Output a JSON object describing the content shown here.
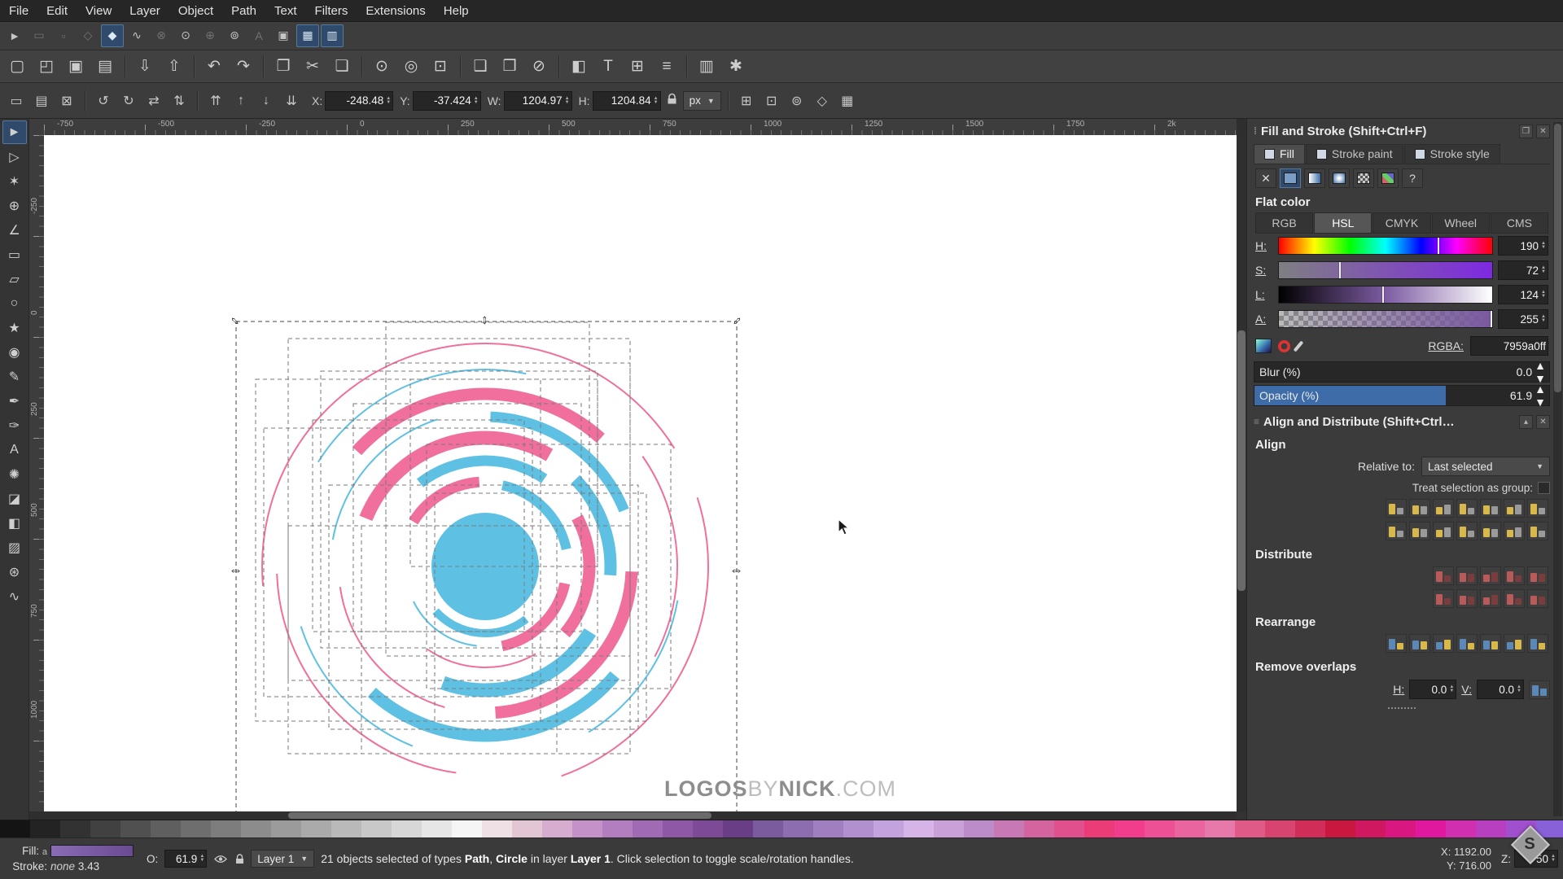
{
  "menu": {
    "items": [
      "File",
      "Edit",
      "View",
      "Layer",
      "Object",
      "Path",
      "Text",
      "Filters",
      "Extensions",
      "Help"
    ]
  },
  "snapbar": {
    "items": [
      {
        "name": "snap-toggle-icon",
        "glyph": "►"
      },
      {
        "name": "snap-bbox-icon",
        "glyph": "▭",
        "dis": true
      },
      {
        "name": "snap-bbox-edge-icon",
        "glyph": "▫",
        "dis": true
      },
      {
        "name": "snap-bbox-corner-icon",
        "glyph": "◇",
        "dis": true
      },
      {
        "name": "snap-node-icon",
        "glyph": "◆",
        "active": true
      },
      {
        "name": "snap-path-icon",
        "glyph": "∿"
      },
      {
        "name": "snap-path-intersection-icon",
        "glyph": "⊗",
        "dis": true
      },
      {
        "name": "snap-cusp-node-icon",
        "glyph": "⊙"
      },
      {
        "name": "snap-midpoint-icon",
        "glyph": "⊕",
        "dis": true
      },
      {
        "name": "snap-center-icon",
        "glyph": "⊚"
      },
      {
        "name": "snap-text-baseline-icon",
        "glyph": "A",
        "dis": true
      },
      {
        "name": "snap-page-border-icon",
        "glyph": "▣"
      },
      {
        "name": "snap-grid-icon",
        "glyph": "▦",
        "active": true
      },
      {
        "name": "snap-guide-icon",
        "glyph": "▥",
        "active": true
      }
    ]
  },
  "commands": {
    "items": [
      {
        "name": "new-document-button",
        "glyph": "▢"
      },
      {
        "name": "open-button",
        "glyph": "◰"
      },
      {
        "name": "save-button",
        "glyph": "▣"
      },
      {
        "name": "print-button",
        "glyph": "▤"
      },
      {
        "sep": true
      },
      {
        "name": "import-button",
        "glyph": "⇩"
      },
      {
        "name": "export-button",
        "glyph": "⇧"
      },
      {
        "sep": true
      },
      {
        "name": "undo-button",
        "glyph": "↶"
      },
      {
        "name": "redo-button",
        "glyph": "↷"
      },
      {
        "sep": true
      },
      {
        "name": "copy-button",
        "glyph": "❐"
      },
      {
        "name": "cut-button",
        "glyph": "✂"
      },
      {
        "name": "paste-button",
        "glyph": "❏"
      },
      {
        "sep": true
      },
      {
        "name": "zoom-selection-button",
        "glyph": "⊙"
      },
      {
        "name": "zoom-drawing-button",
        "glyph": "◎"
      },
      {
        "name": "zoom-page-button",
        "glyph": "⊡"
      },
      {
        "sep": true
      },
      {
        "name": "duplicate-button",
        "glyph": "❑"
      },
      {
        "name": "clone-button",
        "glyph": "❒"
      },
      {
        "name": "unlink-clone-button",
        "glyph": "⊘"
      },
      {
        "sep": true
      },
      {
        "name": "fill-stroke-dialog-button",
        "glyph": "◧"
      },
      {
        "name": "text-dialog-button",
        "glyph": "T"
      },
      {
        "name": "xml-editor-button",
        "glyph": "⊞"
      },
      {
        "name": "align-dialog-button",
        "glyph": "≡"
      },
      {
        "sep": true
      },
      {
        "name": "document-properties-button",
        "glyph": "▥"
      },
      {
        "name": "preferences-button",
        "glyph": "✱"
      }
    ]
  },
  "tool_options": {
    "left_icons": [
      {
        "name": "select-all-button",
        "glyph": "▭"
      },
      {
        "name": "select-all-layers-button",
        "glyph": "▤"
      },
      {
        "name": "deselect-button",
        "glyph": "⊠"
      },
      {
        "sep": true
      },
      {
        "name": "rotate-ccw-button",
        "glyph": "↺"
      },
      {
        "name": "rotate-cw-button",
        "glyph": "↻"
      },
      {
        "name": "flip-horizontal-button",
        "glyph": "⇄"
      },
      {
        "name": "flip-vertical-button",
        "glyph": "⇅"
      },
      {
        "sep": true
      },
      {
        "name": "raise-to-top-button",
        "glyph": "⇈"
      },
      {
        "name": "raise-button",
        "glyph": "↑"
      },
      {
        "name": "lower-button",
        "glyph": "↓"
      },
      {
        "name": "lower-to-bottom-button",
        "glyph": "⇊"
      }
    ],
    "fields": [
      {
        "name": "x-field",
        "label": "X:",
        "value": "-248.48"
      },
      {
        "name": "y-field",
        "label": "Y:",
        "value": "-37.424"
      },
      {
        "name": "w-field",
        "label": "W:",
        "value": "1204.97"
      },
      {
        "name": "h-field",
        "label": "H:",
        "value": "1204.84"
      }
    ],
    "unit": "px",
    "right_icons": [
      {
        "name": "affect-move-toggle",
        "glyph": "⊞"
      },
      {
        "name": "affect-scale-toggle",
        "glyph": "⊡"
      },
      {
        "name": "affect-rotate-toggle",
        "glyph": "⊚"
      },
      {
        "name": "affect-corners-toggle",
        "glyph": "◇"
      },
      {
        "name": "bbox-mode-toggle",
        "glyph": "▦"
      }
    ]
  },
  "toolbox": {
    "tools": [
      {
        "name": "selector-tool",
        "glyph": "►",
        "active": true
      },
      {
        "name": "node-tool",
        "glyph": "▷"
      },
      {
        "name": "tweak-tool",
        "glyph": "✶"
      },
      {
        "name": "zoom-tool",
        "glyph": "⊕"
      },
      {
        "name": "measure-tool",
        "glyph": "∠"
      },
      {
        "name": "rectangle-tool",
        "glyph": "▭"
      },
      {
        "name": "box3d-tool",
        "glyph": "▱"
      },
      {
        "name": "ellipse-tool",
        "glyph": "○"
      },
      {
        "name": "star-tool",
        "glyph": "★"
      },
      {
        "name": "spiral-tool",
        "glyph": "◉"
      },
      {
        "name": "pencil-tool",
        "glyph": "✎"
      },
      {
        "name": "bezier-tool",
        "glyph": "✒"
      },
      {
        "name": "calligraphy-tool",
        "glyph": "✑"
      },
      {
        "name": "text-tool",
        "glyph": "A"
      },
      {
        "name": "spray-tool",
        "glyph": "✺"
      },
      {
        "name": "eraser-tool",
        "glyph": "◪"
      },
      {
        "name": "paint-bucket-tool",
        "glyph": "◧"
      },
      {
        "name": "gradient-tool",
        "glyph": "▨"
      },
      {
        "name": "dropper-tool",
        "glyph": "⊛"
      },
      {
        "name": "connector-tool",
        "glyph": "∿"
      }
    ]
  },
  "rulers": {
    "h_labels": [
      "-750",
      "-500",
      "-250",
      "0",
      "250",
      "500",
      "750",
      "1000",
      "1250",
      "1500",
      "1750",
      "2k"
    ],
    "v_labels": [
      "-250",
      "0",
      "250",
      "500",
      "750",
      "1000"
    ]
  },
  "fill_stroke": {
    "title": "Fill and Stroke (Shift+Ctrl+F)",
    "tabs": [
      {
        "label": "Fill",
        "active": true
      },
      {
        "label": "Stroke paint"
      },
      {
        "label": "Stroke style"
      }
    ],
    "paint_buttons": [
      {
        "name": "paint-none-button",
        "glyph": "✕"
      },
      {
        "name": "paint-flat-button",
        "kind": "flat",
        "active": true
      },
      {
        "name": "paint-linear-gradient-button",
        "kind": "linear"
      },
      {
        "name": "paint-radial-gradient-button",
        "kind": "radial"
      },
      {
        "name": "paint-pattern-button",
        "kind": "pattern"
      },
      {
        "name": "paint-swatch-button",
        "kind": "swatch"
      },
      {
        "name": "paint-unknown-button",
        "glyph": "?"
      }
    ],
    "flat_color_label": "Flat color",
    "color_tabs": [
      {
        "label": "RGB"
      },
      {
        "label": "HSL",
        "active": true
      },
      {
        "label": "CMYK"
      },
      {
        "label": "Wheel"
      },
      {
        "label": "CMS"
      }
    ],
    "sliders": [
      {
        "name": "hue-slider",
        "label": "H:",
        "value": "190",
        "pos": 74.5,
        "grad": "h"
      },
      {
        "name": "saturation-slider",
        "label": "S:",
        "value": "72",
        "pos": 28.2,
        "grad": "s"
      },
      {
        "name": "lightness-slider",
        "label": "L:",
        "value": "124",
        "pos": 48.6,
        "grad": "l"
      },
      {
        "name": "alpha-slider",
        "label": "A:",
        "value": "255",
        "pos": 99.2,
        "grad": "a"
      }
    ],
    "rgba_label": "RGBA:",
    "rgba_value": "7959a0ff",
    "blur_label": "Blur (%)",
    "blur_value": "0.0",
    "blur_fill": 0,
    "opacity_label": "Opacity (%)",
    "opacity_value": "61.9",
    "opacity_fill": 65
  },
  "align": {
    "title": "Align and Distribute (Shift+Ctrl…",
    "align_header": "Align",
    "relative_label": "Relative to:",
    "relative_value": "Last selected",
    "treat_label": "Treat selection as group:",
    "row1": [
      "align-right-to-left-anchor",
      "align-left-edges",
      "center-on-vertical-axis",
      "align-right-edges",
      "align-left-to-right-anchor",
      "align-text-left",
      "align-baseline-h"
    ],
    "row2": [
      "align-bottom-to-top-anchor",
      "align-top-edges",
      "center-on-horizontal-axis",
      "align-bottom-edges",
      "align-top-to-bottom-anchor",
      "align-text-top",
      "align-baseline-v"
    ],
    "distribute_header": "Distribute",
    "dist1": [
      "distribute-left-edges",
      "distribute-centers-horizontally",
      "distribute-right-edges",
      "distribute-horizontal-gaps",
      "distribute-text-h"
    ],
    "dist2": [
      "distribute-top-edges",
      "distribute-centers-vertically",
      "distribute-bottom-edges",
      "distribute-vertical-gaps",
      "distribute-text-v"
    ],
    "rearrange_header": "Rearrange",
    "rearrange": [
      "arrange-connector-network",
      "exchange-in-selection-order",
      "exchange-in-stacking-order",
      "exchange-clockwise",
      "randomize-centers",
      "unclump",
      "remove-overlaps-icon"
    ],
    "remove_header": "Remove overlaps",
    "h_label": "H:",
    "h_value": "0.0",
    "v_label": "V:",
    "v_value": "0.0"
  },
  "statusbar": {
    "fill_label": "Fill:",
    "fill_flag": "a",
    "stroke_label": "Stroke:",
    "stroke_value": "none",
    "stroke_width": "3.43",
    "opacity_label": "O:",
    "opacity_value": "61.9",
    "layer_name": "Layer 1",
    "message": {
      "s1": "21 objects selected of types ",
      "b1": "Path",
      "s2": ", ",
      "b2": "Circle",
      "s3": " in layer ",
      "b3": "Layer 1",
      "s4": ". Click selection to toggle scale/rotation handles."
    },
    "x_label": "X:",
    "x_value": "1192.00",
    "y_label": "Y:",
    "y_value": "716.00",
    "z_label": "Z:",
    "z_value": "50"
  },
  "canvas": {
    "watermark": {
      "p1": "LOGOS",
      "p2": "BY",
      "p3": "NICK",
      "p4": ".COM"
    }
  },
  "palette": {
    "colors": [
      "#141414",
      "#232323",
      "#323232",
      "#414141",
      "#505050",
      "#5f5f5f",
      "#6e6e6e",
      "#7d7d7d",
      "#8c8c8c",
      "#9b9b9b",
      "#aaaaaa",
      "#b9b9b9",
      "#c8c8c8",
      "#d7d7d7",
      "#e6e6e6",
      "#f5f5f5",
      "#efe0e6",
      "#e3c6d4",
      "#d6accf",
      "#c492c8",
      "#b27ec0",
      "#a06ab4",
      "#8e58a6",
      "#7c4a96",
      "#6a3e86",
      "#7c5a9e",
      "#8e6cb0",
      "#a07ec0",
      "#b290d0",
      "#c4a2de",
      "#d6b4e8",
      "#caa0d8",
      "#bc8cc8",
      "#c878b4",
      "#d464a0",
      "#e0508c",
      "#ec3c78",
      "#f23c8c",
      "#ee5096",
      "#ea64a0",
      "#e678aa",
      "#e05a88",
      "#d84470",
      "#d02e58",
      "#c81840",
      "#d01860",
      "#d81880",
      "#e018a0",
      "#d030b0",
      "#b840c0",
      "#a050cc",
      "#8860d8",
      "#7070e0"
    ]
  }
}
